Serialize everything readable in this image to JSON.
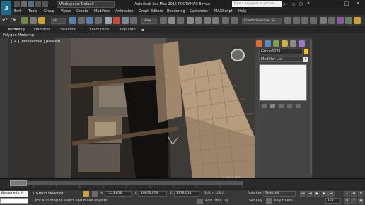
{
  "window": {
    "workspace": "Workspace: Default",
    "title": "Autodesk 3ds Max  2015     ГОСТИНАЯ 8.max",
    "search_placeholder": "Type a keyword or phrase"
  },
  "menu": [
    "Edit",
    "Tools",
    "Group",
    "Views",
    "Create",
    "Modifiers",
    "Animation",
    "Graph Editors",
    "Rendering",
    "Customize",
    "MAXScript",
    "Help"
  ],
  "toolbar": {
    "selection_filter": "All",
    "ref_coord": "View",
    "named_selection": "Create Selection Se"
  },
  "ribbon": {
    "tabs": [
      "Modeling",
      "Freeform",
      "Selection",
      "Object Paint",
      "Populate"
    ],
    "sub_label": "Polygon Modeling"
  },
  "viewport": {
    "label": "[ + ] [Perspective ] [Realisti"
  },
  "command_panel": {
    "object_name": "Group5271",
    "modifier_list": "Modifier List",
    "colors": {
      "object_color": "#e8c020"
    }
  },
  "timeline": {
    "frame_counter": "100 / 100"
  },
  "status": {
    "maxscript": "Welcome to M",
    "selection": "1 Group Selected",
    "prompt": "Click and drag to select and move objects",
    "x_label": "X:",
    "x_value": "1223,656",
    "y_label": "Y:",
    "y_value": "10670,074",
    "z_label": "Z:",
    "z_value": "3376,014",
    "grid": "Grid = 100,0",
    "auto_key": "Auto Key",
    "selected": "Selected",
    "set_key": "Set Key",
    "key_filters": "Key Filters...",
    "add_time_tag": "Add Time Tag",
    "frame": "100"
  },
  "icons": [
    "app-logo-icon",
    "undo-icon",
    "redo-icon",
    "link-icon",
    "select-icon",
    "move-icon",
    "rotate-icon",
    "scale-icon",
    "snap-icon",
    "render-icon",
    "viewcube-icon",
    "play-icon",
    "key-icon"
  ]
}
